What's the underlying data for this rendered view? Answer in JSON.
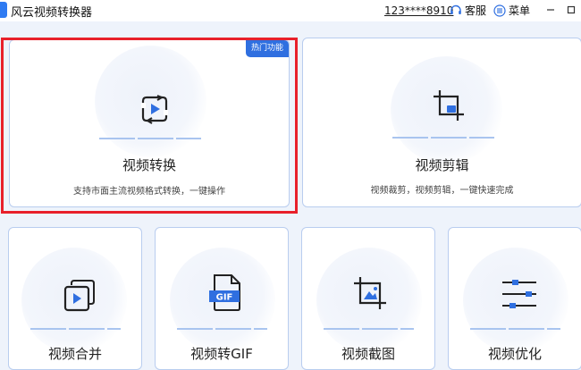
{
  "app": {
    "title": "风云视频转换器"
  },
  "header": {
    "phone": "123****8910",
    "service_label": "客服",
    "menu_label": "菜单"
  },
  "features": {
    "convert": {
      "title": "视频转换",
      "desc": "支持市面主流视频格式转换，一键操作",
      "badge": "热门功能"
    },
    "edit": {
      "title": "视频剪辑",
      "desc": "视频裁剪，视频剪辑，一键快速完成"
    },
    "merge": {
      "title": "视频合并"
    },
    "gif": {
      "title": "视频转GIF",
      "icon_text": "GIF"
    },
    "crop": {
      "title": "视频截图"
    },
    "optimize": {
      "title": "视频优化"
    }
  },
  "colors": {
    "accent": "#2f6fe0",
    "highlight": "#e8202a"
  }
}
